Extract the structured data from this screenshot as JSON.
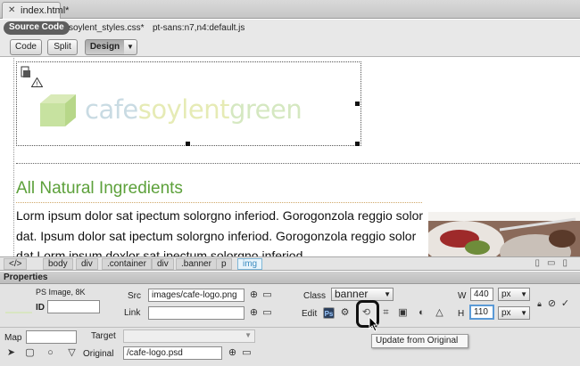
{
  "tab": {
    "title": "index.html*"
  },
  "related_files": {
    "source_code": "Source Code",
    "files": [
      "soylent_styles.css*",
      "pt-sans:n7,n4:default.js"
    ]
  },
  "view_buttons": {
    "code": "Code",
    "split": "Split",
    "design": "Design"
  },
  "page": {
    "logo": {
      "part1": "cafe",
      "part2": "soylent",
      "part3": "green"
    },
    "heading": "All Natural Ingredients",
    "paragraph": "Lorm ipsum dolor sat ipectum solorgno inferiod. Gorogonzola reggio solor dat. Ipsum dolor sat ipectum solorgno inferiod. Gorogonzola reggio solor dat Lorm ipsum doxlor sat ipectum solorgno inferiod."
  },
  "tag_selector": [
    "</>",
    "body",
    "div",
    ".container",
    "div",
    ".banner",
    "p",
    "img"
  ],
  "properties": {
    "title": "Properties",
    "item_type": "PS Image, 8K",
    "id_label": "ID",
    "id_value": "",
    "src_label": "Src",
    "src_value": "images/cafe-logo.png",
    "link_label": "Link",
    "link_value": "",
    "class_label": "Class",
    "class_value": "banner",
    "edit_label": "Edit",
    "w_label": "W",
    "w_value": "440",
    "w_unit": "px",
    "h_label": "H",
    "h_value": "110",
    "h_unit": "px",
    "map_label": "Map",
    "map_value": "",
    "target_label": "Target",
    "target_value": "",
    "original_label": "Original",
    "original_value": "/cafe-logo.psd",
    "tooltip": "Update from Original"
  },
  "colors": {
    "heading": "#5da13b",
    "selected_tag": "#3c8cc0",
    "focus_border": "#5b9ad6"
  },
  "icons": [
    "close-icon",
    "photoshop-icon",
    "warning-icon",
    "point-to-file-icon",
    "folder-icon",
    "photoshop-edit-icon",
    "settings-icon",
    "update-from-original-icon",
    "crop-icon",
    "resample-icon",
    "brightness-contrast-icon",
    "sharpen-icon",
    "lock-icon",
    "reset-size-icon",
    "commit-icon",
    "pointer-hotspot-tool-icon",
    "rect-hotspot-icon",
    "circle-hotspot-icon",
    "polygon-hotspot-icon"
  ]
}
